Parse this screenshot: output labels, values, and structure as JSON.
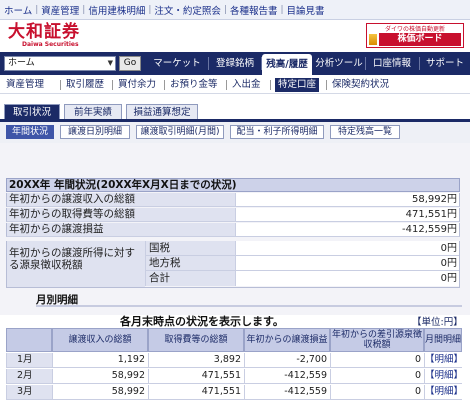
{
  "topbar": {
    "links": [
      "ホーム",
      "資産管理",
      "信用建株明細",
      "注文・約定照会",
      "各種報告書",
      "目論見書"
    ]
  },
  "header": {
    "logo_text": "大和証券",
    "logo_sub": "Daiwa Securities",
    "promo_top": "ダイワの株価自動更新",
    "promo_bottom": "株価ボード"
  },
  "mainnav": {
    "select_value": "ホーム",
    "go_label": "Go",
    "items": [
      "マーケット",
      "登録銘柄",
      "残高/履歴",
      "分析ツール",
      "口座情報",
      "サポート"
    ],
    "active_index": 2
  },
  "subnav": {
    "items": [
      "資産管理",
      "取引履歴",
      "買付余力",
      "お預り金等",
      "入出金",
      "特定口座",
      "保険契約状況"
    ],
    "active_index": 5
  },
  "tabs": {
    "items": [
      "取引状況",
      "前年実績",
      "損益通算想定"
    ],
    "active_index": 0
  },
  "subtabs": {
    "items": [
      "年間状況",
      "譲渡日別明細",
      "譲渡取引明細(月間)",
      "配当・利子所得明細",
      "特定残高一覧"
    ],
    "active_index": 0
  },
  "summary": {
    "header": "20XX年 年間状況(20XX年X月X日までの状況)",
    "rows": [
      {
        "label": "年初からの譲渡収入の総額",
        "value": "58,992円"
      },
      {
        "label": "年初からの取得費等の総額",
        "value": "471,551円"
      },
      {
        "label": "年初からの譲渡損益",
        "value": "-412,559円"
      }
    ],
    "tax_label": "年初からの譲渡所得に対する源泉徴収税額",
    "tax_rows": [
      {
        "label": "国税",
        "value": "0円"
      },
      {
        "label": "地方税",
        "value": "0円"
      },
      {
        "label": "合計",
        "value": "0円"
      }
    ]
  },
  "monthly": {
    "title": "月別明細",
    "message": "各月末時点の状況を表示します。",
    "unit": "【単位:円】",
    "headers": [
      "",
      "譲渡収入の総額",
      "取得費等の総額",
      "年初からの譲渡損益",
      "年初からの差引源泉徴収税額",
      "月間明細"
    ],
    "rows": [
      {
        "month": "1月",
        "revenue": "1,192",
        "cost": "3,892",
        "pl": "-2,700",
        "tax": "0",
        "link": "【明細】"
      },
      {
        "month": "2月",
        "revenue": "58,992",
        "cost": "471,551",
        "pl": "-412,559",
        "tax": "0",
        "link": "【明細】"
      },
      {
        "month": "3月",
        "revenue": "58,992",
        "cost": "471,551",
        "pl": "-412,559",
        "tax": "0",
        "link": "【明細】"
      }
    ]
  }
}
